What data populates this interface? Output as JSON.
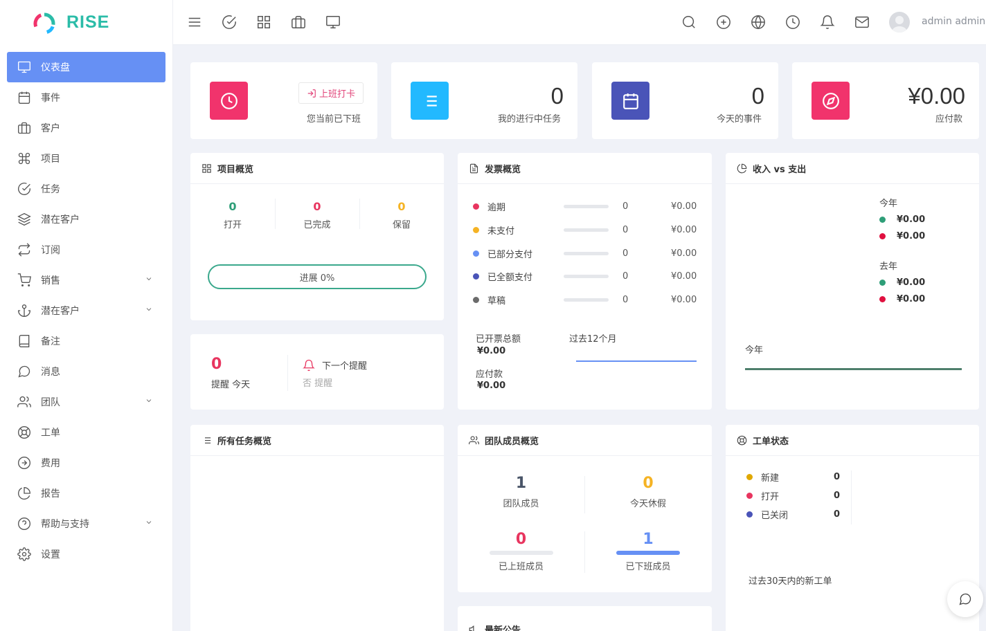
{
  "brand": {
    "name": "RISE"
  },
  "sidebar": {
    "items": [
      {
        "label": "仪表盘",
        "icon": "monitor-icon",
        "active": true
      },
      {
        "label": "事件",
        "icon": "calendar-icon"
      },
      {
        "label": "客户",
        "icon": "briefcase-icon"
      },
      {
        "label": "项目",
        "icon": "command-icon"
      },
      {
        "label": "任务",
        "icon": "check-circle-icon"
      },
      {
        "label": "潜在客户",
        "icon": "layers-icon"
      },
      {
        "label": "订阅",
        "icon": "repeat-icon"
      },
      {
        "label": "销售",
        "icon": "shopping-cart-icon",
        "has_submenu": true
      },
      {
        "label": "潜在客户",
        "icon": "anchor-icon",
        "has_submenu": true
      },
      {
        "label": "备注",
        "icon": "book-icon"
      },
      {
        "label": "消息",
        "icon": "message-circle-icon"
      },
      {
        "label": "团队",
        "icon": "users-icon",
        "has_submenu": true
      },
      {
        "label": "工单",
        "icon": "life-buoy-icon"
      },
      {
        "label": "费用",
        "icon": "arrow-right-circle-icon"
      },
      {
        "label": "报告",
        "icon": "pie-chart-icon"
      },
      {
        "label": "帮助与支持",
        "icon": "help-circle-icon",
        "has_submenu": true
      },
      {
        "label": "设置",
        "icon": "settings-icon"
      }
    ]
  },
  "topbar": {
    "left_icons": [
      "menu-icon",
      "check-circle-icon",
      "grid-icon",
      "briefcase-icon",
      "monitor-icon"
    ],
    "right_icons": [
      "search-icon",
      "plus-circle-icon",
      "globe-icon",
      "clock-icon",
      "bell-icon",
      "mail-icon"
    ],
    "user_name": "admin admin"
  },
  "stats": {
    "clock": {
      "button_label": "上班打卡",
      "status": "您当前已下班",
      "color": "#f1336c"
    },
    "tasks": {
      "value": "0",
      "label": "我的进行中任务",
      "color": "#22b9ff"
    },
    "events": {
      "value": "0",
      "label": "今天的事件",
      "color": "#4a54b8"
    },
    "due": {
      "value": "¥0.00",
      "label": "应付款",
      "color": "#f1336c"
    }
  },
  "projects": {
    "title": "项目概览",
    "open": {
      "value": "0",
      "label": "打开",
      "color": "#2e9e78"
    },
    "completed": {
      "value": "0",
      "label": "已完成",
      "color": "#e8355f"
    },
    "hold": {
      "value": "0",
      "label": "保留",
      "color": "#f5b324"
    },
    "progress_label": "进展 0%",
    "progress": 0
  },
  "reminders": {
    "count": "0",
    "today_label": "提醒 今天",
    "next_label": "下一个提醒",
    "none_label": "否 提醒"
  },
  "invoices": {
    "title": "发票概览",
    "rows": [
      {
        "label": "逾期",
        "count": "0",
        "amount": "¥0.00",
        "color": "#e8355f"
      },
      {
        "label": "未支付",
        "count": "0",
        "amount": "¥0.00",
        "color": "#f5b324"
      },
      {
        "label": "已部分支付",
        "count": "0",
        "amount": "¥0.00",
        "color": "#6690f4"
      },
      {
        "label": "已全额支付",
        "count": "0",
        "amount": "¥0.00",
        "color": "#4a54b8"
      },
      {
        "label": "草稿",
        "count": "0",
        "amount": "¥0.00",
        "color": "#6b6b6b"
      }
    ],
    "total_label": "已开票总额",
    "total_value": "¥0.00",
    "due_label": "应付款",
    "due_value": "¥0.00",
    "period_label": "过去12个月"
  },
  "income": {
    "title": "收入 vs 支出",
    "this_year_label": "今年",
    "this_year_income": "¥0.00",
    "this_year_expense": "¥0.00",
    "last_year_label": "去年",
    "last_year_income": "¥0.00",
    "last_year_expense": "¥0.00",
    "chart_label": "今年",
    "income_color": "#2e9e78",
    "expense_color": "#e8355f"
  },
  "all_tasks": {
    "title": "所有任务概览"
  },
  "team": {
    "title": "团队成员概览",
    "members": {
      "value": "1",
      "label": "团队成员",
      "color": "#4a5568"
    },
    "on_leave": {
      "value": "0",
      "label": "今天休假",
      "color": "#f5b324"
    },
    "clocked_in": {
      "value": "0",
      "label": "已上班成员",
      "color": "#e8355f",
      "fraction": 0
    },
    "clocked_out": {
      "value": "1",
      "label": "已下班成员",
      "color": "#6690f4",
      "fraction": 1
    }
  },
  "tickets": {
    "title": "工单状态",
    "rows": [
      {
        "label": "新建",
        "count": "0",
        "color": "#e0a800"
      },
      {
        "label": "打开",
        "count": "0",
        "color": "#e8355f"
      },
      {
        "label": "已关闭",
        "count": "0",
        "color": "#4a54b8"
      }
    ],
    "footer": "过去30天内的新工单"
  },
  "announcements": {
    "title": "最新公告"
  }
}
